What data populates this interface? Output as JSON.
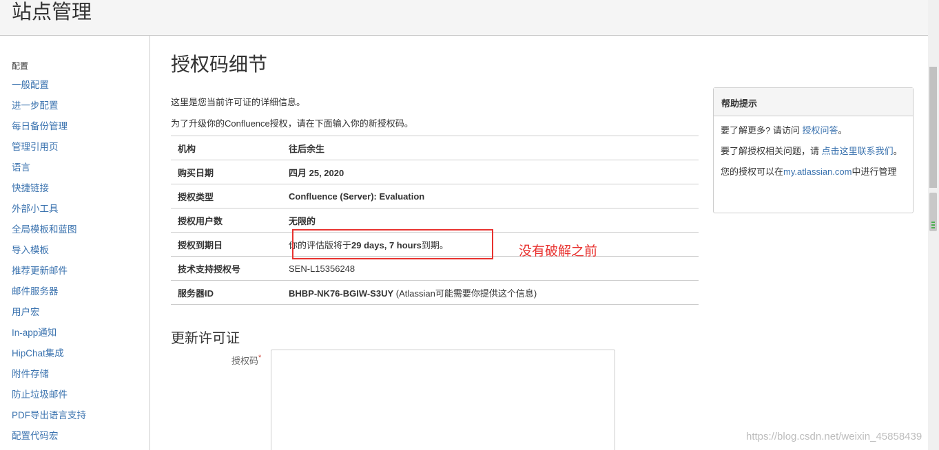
{
  "header": {
    "title": "站点管理"
  },
  "sidebar": {
    "section_title": "配置",
    "items": [
      "一般配置",
      "进一步配置",
      "每日备份管理",
      "管理引用页",
      "语言",
      "快捷链接",
      "外部小工具",
      "全局模板和蓝图",
      "导入模板",
      "推荐更新邮件",
      "邮件服务器",
      "用户宏",
      "In-app通知",
      "HipChat集成",
      "附件存储",
      "防止垃圾邮件",
      "PDF导出语言支持",
      "配置代码宏"
    ]
  },
  "main": {
    "title": "授权码细节",
    "intro1": "这里是您当前许可证的详细信息。",
    "intro2": "为了升级你的Confluence授权，请在下面输入你的新授权码。",
    "rows": {
      "org": {
        "label": "机构",
        "value": "往后余生"
      },
      "purchase": {
        "label": "购买日期",
        "value": "四月 25, 2020"
      },
      "type": {
        "label": "授权类型",
        "value": "Confluence (Server): Evaluation"
      },
      "users": {
        "label": "授权用户数",
        "value": "无限的"
      },
      "expiry": {
        "label": "授权到期日",
        "prefix": "你的评估版将于",
        "bold": "29 days, 7 hours",
        "suffix": "到期。"
      },
      "sen": {
        "label": "技术支持授权号",
        "value": "SEN-L15356248"
      },
      "server": {
        "label": "服务器ID",
        "bold": "BHBP-NK76-BGIW-S3UY",
        "suffix": " (Atlassian可能需要你提供这个信息)"
      }
    },
    "annotation": "没有破解之前",
    "renew_title": "更新许可证",
    "license_label": "授权码",
    "required_mark": "*"
  },
  "help": {
    "title": "帮助提示",
    "p1_text": "要了解更多? 请访问 ",
    "p1_link": "授权问答",
    "p1_end": "。",
    "p2_text": "要了解授权相关问题，请 ",
    "p2_link": "点击这里联系我们",
    "p2_end": "。",
    "p3_text": "您的授权可以在",
    "p3_link": "my.atlassian.com",
    "p3_end": "中进行管理"
  },
  "watermark": "https://blog.csdn.net/weixin_45858439",
  "colors": {
    "link": "#3b73af",
    "annotation": "#e8322f",
    "required": "#d04437"
  }
}
